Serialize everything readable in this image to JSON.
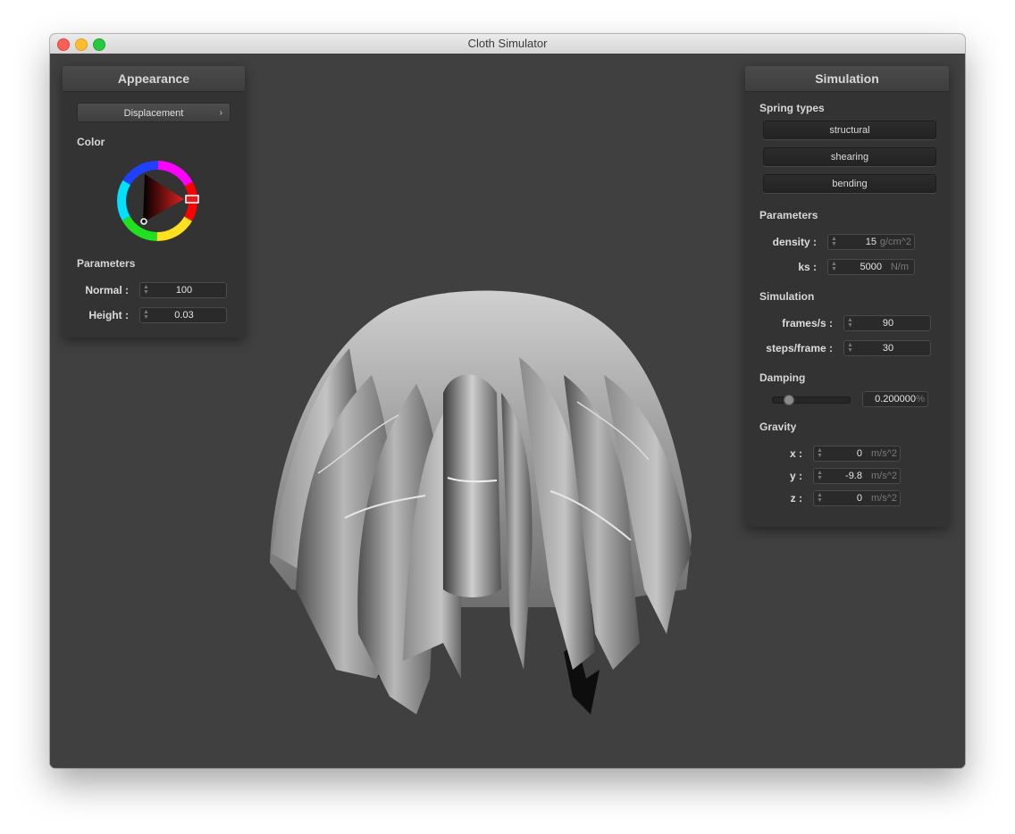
{
  "window": {
    "title": "Cloth Simulator"
  },
  "appearance": {
    "title": "Appearance",
    "shader_dropdown": "Displacement",
    "color_label": "Color",
    "params_label": "Parameters",
    "normal": {
      "label": "Normal :",
      "value": "100"
    },
    "height": {
      "label": "Height :",
      "value": "0.03"
    }
  },
  "simulation_panel": {
    "title": "Simulation",
    "spring_types_label": "Spring types",
    "spring_buttons": [
      "structural",
      "shearing",
      "bending"
    ],
    "params_label": "Parameters",
    "density": {
      "label": "density :",
      "value": "15",
      "unit": "g/cm^2"
    },
    "ks": {
      "label": "ks :",
      "value": "5000",
      "unit": "N/m"
    },
    "sim_label": "Simulation",
    "frames": {
      "label": "frames/s :",
      "value": "90"
    },
    "steps": {
      "label": "steps/frame :",
      "value": "30"
    },
    "damping_label": "Damping",
    "damping": {
      "value": "0.200000",
      "unit": "%",
      "slider_fraction": 0.2
    },
    "gravity_label": "Gravity",
    "gx": {
      "label": "x :",
      "value": "0",
      "unit": "m/s^2"
    },
    "gy": {
      "label": "y :",
      "value": "-9.8",
      "unit": "m/s^2"
    },
    "gz": {
      "label": "z :",
      "value": "0",
      "unit": "m/s^2"
    }
  },
  "colors": {
    "viewport_bg": "#404040",
    "panel_bg": "#333333",
    "selected_color": "#e02020"
  }
}
